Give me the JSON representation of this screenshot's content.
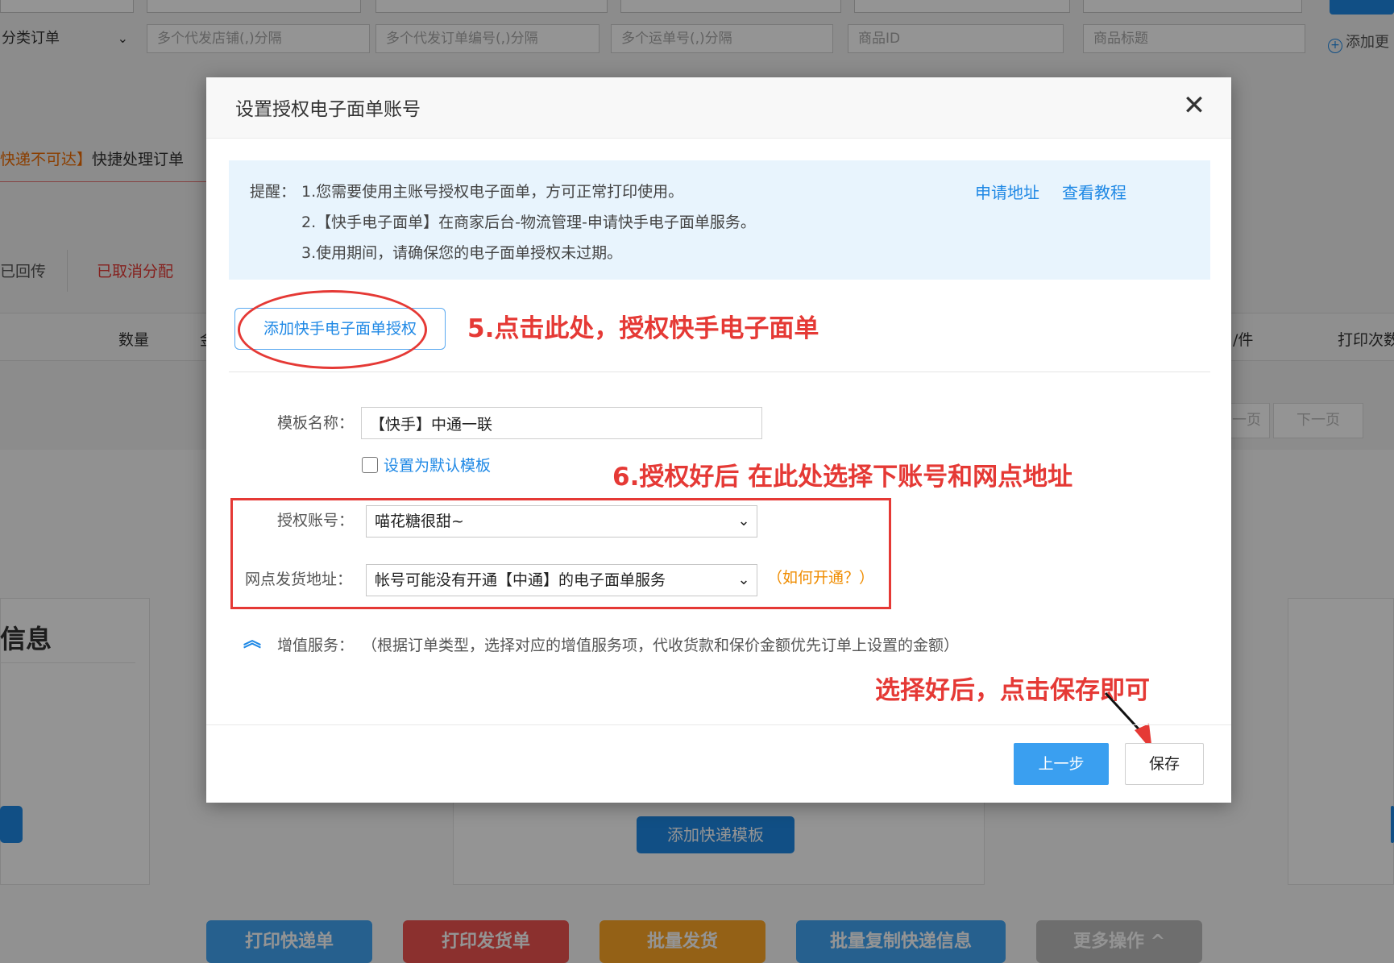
{
  "background": {
    "filters": {
      "category_select": "分类订单",
      "placeholders": [
        "多个代发店铺(,)分隔",
        "多个代发订单编号(,)分隔",
        "多个运单号(,)分隔",
        "商品ID",
        "商品标题"
      ],
      "add_more": "添加更"
    },
    "alert": {
      "highlight": "快递不可达】",
      "text": "快捷处理订单"
    },
    "tabs": [
      "已回传",
      "已取消分配"
    ],
    "table_headers": {
      "quantity": "数量",
      "amount_partial": "金",
      "per_unit": "/件",
      "print_count": "打印次数"
    },
    "pager": {
      "prev": "上一页",
      "next": "下一页"
    },
    "card_title": "信息",
    "add_template_button": "添加快递模板",
    "bottom_buttons": [
      "打印快递单",
      "打印发货单",
      "批量发货",
      "批量复制快递信息",
      "更多操作 ^"
    ]
  },
  "modal": {
    "title": "设置授权电子面单账号",
    "close_symbol": "✕",
    "tip": {
      "label": "提醒：",
      "lines": [
        "1.您需要使用主账号授权电子面单，方可正常打印使用。",
        "2.【快手电子面单】在商家后台-物流管理-申请快手电子面单服务。",
        "3.使用期间，请确保您的电子面单授权未过期。"
      ],
      "links": [
        "申请地址",
        "查看教程"
      ]
    },
    "auth_button": "添加快手电子面单授权",
    "annotations": {
      "step5": "5.点击此处，授权快手电子面单",
      "step6": "6.授权好后 在此处选择下账号和网点地址",
      "save_hint": "选择好后，点击保存即可"
    },
    "form": {
      "template_name_label": "模板名称：",
      "template_name_value": "【快手】中通一联",
      "default_checkbox_label": "设置为默认模板",
      "account_label": "授权账号：",
      "account_value": "喵花糖很甜~",
      "branch_label": "网点发货地址：",
      "branch_value": "帐号可能没有开通【中通】的电子面单服务",
      "how_to_open": "（如何开通？）",
      "vas_label": "增值服务：",
      "vas_desc": "（根据订单类型，选择对应的增值服务项，代收货款和保价金额优先订单上设置的金额）"
    },
    "buttons": {
      "prev": "上一步",
      "save": "保存"
    }
  },
  "colors": {
    "accent_blue": "#1e88e5",
    "annotation_red": "#e53935",
    "link_orange": "#ef8c00",
    "tip_bg": "#e8f4fd"
  }
}
